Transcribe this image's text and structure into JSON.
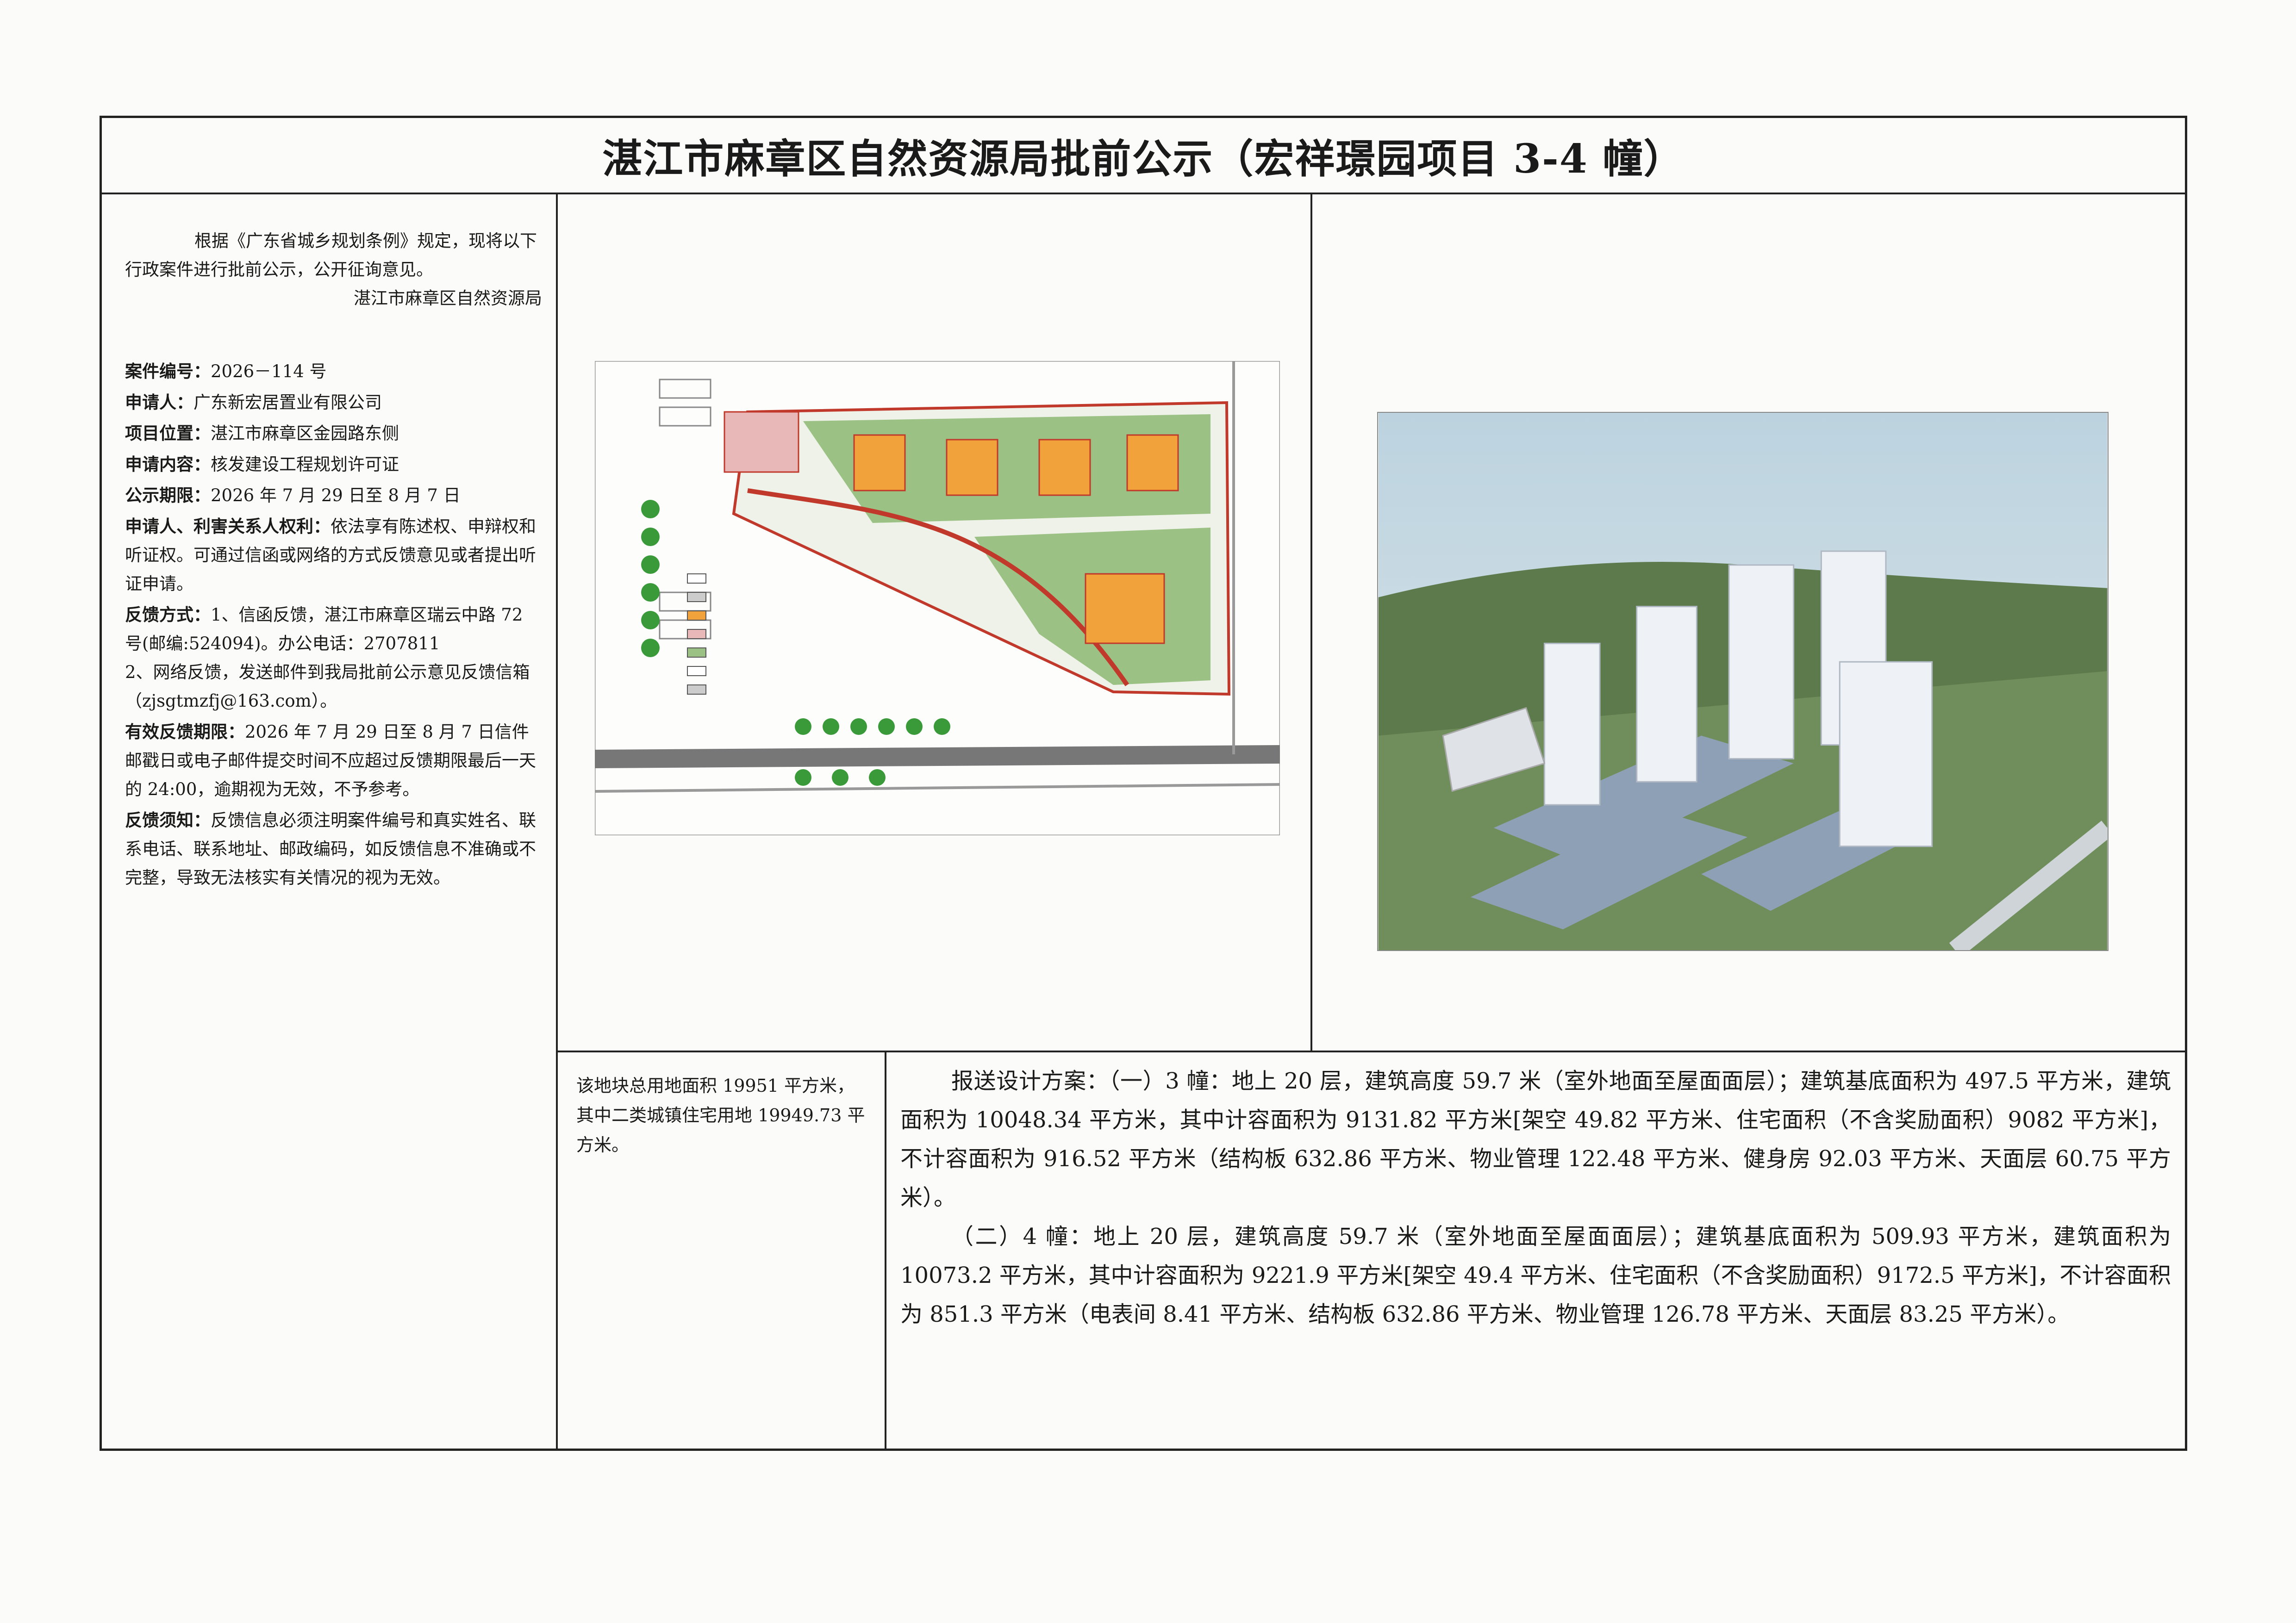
{
  "title": "湛江市麻章区自然资源局批前公示（宏祥璟园项目 3-4 幢）",
  "intro": "根据《广东省城乡规划条例》规定，现将以下行政案件进行批前公示，公开征询意见。",
  "issuer": "湛江市麻章区自然资源局",
  "fields": {
    "case_no_label": "案件编号：",
    "case_no": "2026－114 号",
    "applicant_label": "申请人：",
    "applicant": "广东新宏居置业有限公司",
    "location_label": "项目位置：",
    "location": "湛江市麻章区金园路东侧",
    "content_label": "申请内容：",
    "content": "核发建设工程规划许可证",
    "period_label": "公示期限：",
    "period": "2026 年 7 月 29 日至 8 月 7 日",
    "rights_label": "申请人、利害关系人权利：",
    "rights": "依法享有陈述权、申辩权和听证权。可通过信函或网络的方式反馈意见或者提出听证申请。",
    "feedback_label": "反馈方式：",
    "feedback1": "1、信函反馈，湛江市麻章区瑞云中路 72 号(邮编:524094)。办公电话：2707811",
    "feedback2": "2、网络反馈，发送邮件到我局批前公示意见反馈信箱（zjsgtmzfj@163.com）。",
    "deadline_label": "有效反馈期限：",
    "deadline": "2026 年 7 月 29 日至 8 月 7 日信件邮戳日或电子邮件提交时间不应超过反馈期限最后一天的 24:00，逾期视为无效，不予参考。",
    "notice_label": "反馈须知：",
    "notice": "反馈信息必须注明案件编号和真实姓名、联系电话、联系地址、邮政编码，如反馈信息不准确或不完整，导致无法核实有关情况的视为无效。"
  },
  "land_info": "该地块总用地面积 19951 平方米，其中二类城镇住宅用地 19949.73 平方米。",
  "design": {
    "p1": "报送设计方案：（一）3 幢：地上 20 层，建筑高度 59.7 米（室外地面至屋面面层）；建筑基底面积为 497.5 平方米，建筑面积为 10048.34 平方米，其中计容面积为 9131.82 平方米[架空 49.82 平方米、住宅面积（不含奖励面积）9082 平方米]，不计容面积为 916.52 平方米（结构板 632.86 平方米、物业管理 122.48 平方米、健身房 92.03 平方米、天面层 60.75 平方米）。",
    "p2": "（二）4 幢：地上 20 层，建筑高度 59.7 米（室外地面至屋面面层）；建筑基底面积为 509.93 平方米，建筑面积为 10073.2 平方米，其中计容面积为 9221.9 平方米[架空 49.4 平方米、住宅面积（不含奖励面积）9172.5 平方米]，不计容面积为 851.3 平方米（电表间 8.41 平方米、结构板 632.86 平方米、物业管理 126.78 平方米、天面层 83.25 平方米）。"
  },
  "colors": {
    "border": "#222222",
    "paper": "#fbfbf9",
    "building": "#f2a23a",
    "green": "#7fb26a",
    "road": "#c0392b"
  }
}
